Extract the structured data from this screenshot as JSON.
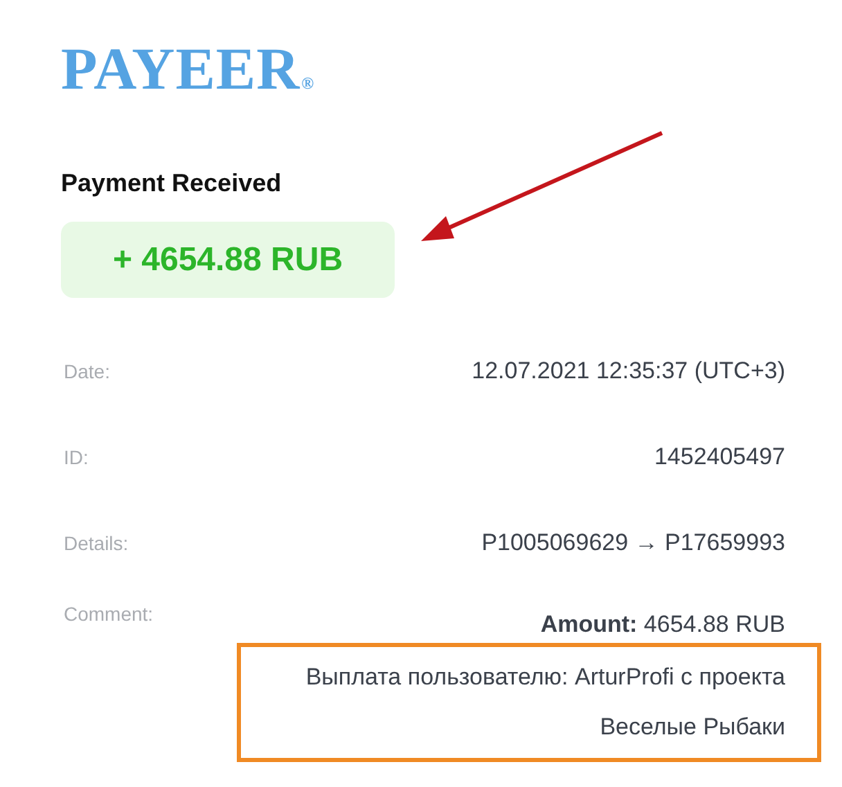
{
  "logo": {
    "text": "PAYEER",
    "mark": "®"
  },
  "heading": "Payment Received",
  "amount_badge": "+ 4654.88 RUB",
  "details": [
    {
      "label": "Date:",
      "value": "12.07.2021 12:35:37 (UTC+3)"
    },
    {
      "label": "ID:",
      "value": "1452405497"
    },
    {
      "label": "Details:",
      "value": "P1005069629 → P17659993"
    }
  ],
  "comment": {
    "label": "Comment:",
    "amount": "**Amount:** 4654.88 RUB",
    "text": "Выплата пользователю: ArturProfi с проекта Веселые Рыбаки"
  }
}
